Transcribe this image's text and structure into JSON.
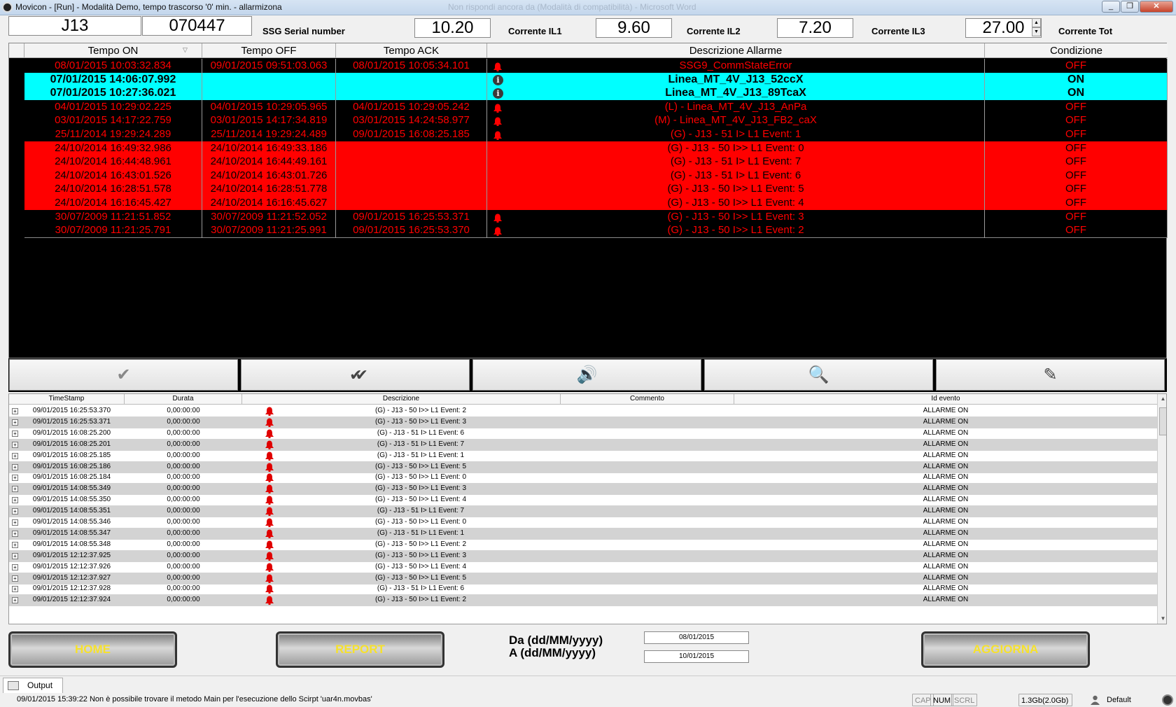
{
  "window": {
    "title": "Movicon - [Run] - Modalità Demo, tempo trascorso '0' min. - allarmizona",
    "ghost_title": "Non rispondi ancora da (Modalità di compatibilità) - Microsoft Word"
  },
  "header": {
    "device": "J13",
    "serial_value": "070447",
    "serial_label": "SSG Serial number",
    "il1_value": "10.20",
    "il1_label": "Corrente IL1",
    "il2_value": "9.60",
    "il2_label": "Corrente IL2",
    "il3_value": "7.20",
    "il3_label": "Corrente IL3",
    "tot_value": "27.00",
    "tot_label": "Corrente Tot"
  },
  "alarm_table": {
    "columns": [
      "Tempo ON",
      "Tempo OFF",
      "Tempo ACK",
      "Descrizione Allarme",
      "Condizione"
    ],
    "rows": [
      {
        "on": "08/01/2015 10:03:32.834",
        "off": "09/01/2015 09:51:03.063",
        "ack": "08/01/2015 10:05:34.101",
        "icon": "bell",
        "desc": "SSG9_CommStateError",
        "cond": "OFF",
        "style": "black"
      },
      {
        "on": "07/01/2015 14:06:07.992",
        "off": "",
        "ack": "",
        "icon": "info",
        "desc": "Linea_MT_4V_J13_52ccX",
        "cond": "ON",
        "style": "cyan"
      },
      {
        "on": "07/01/2015 10:27:36.021",
        "off": "",
        "ack": "",
        "icon": "info",
        "desc": "Linea_MT_4V_J13_89TcaX",
        "cond": "ON",
        "style": "cyan"
      },
      {
        "on": "04/01/2015 10:29:02.225",
        "off": "04/01/2015 10:29:05.965",
        "ack": "04/01/2015 10:29:05.242",
        "icon": "bell",
        "desc": "(L) - Linea_MT_4V_J13_AnPa",
        "cond": "OFF",
        "style": "black"
      },
      {
        "on": "03/01/2015 14:17:22.759",
        "off": "03/01/2015 14:17:34.819",
        "ack": "03/01/2015 14:24:58.977",
        "icon": "bell",
        "desc": "(M) - Linea_MT_4V_J13_FB2_caX",
        "cond": "OFF",
        "style": "black"
      },
      {
        "on": "25/11/2014 19:29:24.289",
        "off": "25/11/2014 19:29:24.489",
        "ack": "09/01/2015 16:08:25.185",
        "icon": "bell",
        "desc": "(G) - J13 - 51 I> L1  Event: 1",
        "cond": "OFF",
        "style": "black"
      },
      {
        "on": "24/10/2014 16:49:32.986",
        "off": "24/10/2014 16:49:33.186",
        "ack": "",
        "icon": "",
        "desc": "(G) - J13 - 50 I>> L1  Event: 0",
        "cond": "OFF",
        "style": "red"
      },
      {
        "on": "24/10/2014 16:44:48.961",
        "off": "24/10/2014 16:44:49.161",
        "ack": "",
        "icon": "",
        "desc": "(G) - J13 - 51 I> L1  Event: 7",
        "cond": "OFF",
        "style": "red"
      },
      {
        "on": "24/10/2014 16:43:01.526",
        "off": "24/10/2014 16:43:01.726",
        "ack": "",
        "icon": "",
        "desc": "(G) - J13 - 51 I> L1  Event: 6",
        "cond": "OFF",
        "style": "red"
      },
      {
        "on": "24/10/2014 16:28:51.578",
        "off": "24/10/2014 16:28:51.778",
        "ack": "",
        "icon": "",
        "desc": "(G) - J13 - 50 I>> L1  Event: 5",
        "cond": "OFF",
        "style": "red"
      },
      {
        "on": "24/10/2014 16:16:45.427",
        "off": "24/10/2014 16:16:45.627",
        "ack": "",
        "icon": "",
        "desc": "(G) - J13 - 50 I>> L1  Event: 4",
        "cond": "OFF",
        "style": "red"
      },
      {
        "on": "30/07/2009 11:21:51.852",
        "off": "30/07/2009 11:21:52.052",
        "ack": "09/01/2015 16:25:53.371",
        "icon": "bell",
        "desc": "(G) - J13 - 50 I>> L1  Event: 3",
        "cond": "OFF",
        "style": "black"
      },
      {
        "on": "30/07/2009 11:21:25.791",
        "off": "30/07/2009 11:21:25.991",
        "ack": "09/01/2015 16:25:53.370",
        "icon": "bell",
        "desc": "(G) - J13 - 50 I>> L1  Event: 2",
        "cond": "OFF",
        "style": "black"
      }
    ]
  },
  "toolbar": {
    "buttons": [
      {
        "name": "ack-selected-button",
        "glyph": "✔"
      },
      {
        "name": "ack-all-button",
        "glyph": "✔✔"
      },
      {
        "name": "silence-horn-button",
        "glyph": "🔊"
      },
      {
        "name": "alarm-help-button",
        "glyph": "🔍"
      },
      {
        "name": "comment-button",
        "glyph": "✎"
      }
    ]
  },
  "history_table": {
    "columns": [
      "TimeStamp",
      "Durata",
      "Descrizione",
      "Commento",
      "Id evento"
    ],
    "rows": [
      {
        "ts": "09/01/2015 16:25:53.370",
        "dur": "0,00:00:00",
        "desc": "(G) - J13 - 50 I>> L1  Event: 2",
        "id": "ALLARME ON"
      },
      {
        "ts": "09/01/2015 16:25:53.371",
        "dur": "0,00:00:00",
        "desc": "(G) - J13 - 50 I>> L1  Event: 3",
        "id": "ALLARME ON"
      },
      {
        "ts": "09/01/2015 16:08:25.200",
        "dur": "0,00:00:00",
        "desc": "(G) - J13 - 51 I> L1  Event: 6",
        "id": "ALLARME ON"
      },
      {
        "ts": "09/01/2015 16:08:25.201",
        "dur": "0,00:00:00",
        "desc": "(G) - J13 - 51 I> L1  Event: 7",
        "id": "ALLARME ON"
      },
      {
        "ts": "09/01/2015 16:08:25.185",
        "dur": "0,00:00:00",
        "desc": "(G) - J13 - 51 I> L1  Event: 1",
        "id": "ALLARME ON"
      },
      {
        "ts": "09/01/2015 16:08:25.186",
        "dur": "0,00:00:00",
        "desc": "(G) - J13 - 50 I>> L1  Event: 5",
        "id": "ALLARME ON"
      },
      {
        "ts": "09/01/2015 16:08:25.184",
        "dur": "0,00:00:00",
        "desc": "(G) - J13 - 50 I>> L1  Event: 0",
        "id": "ALLARME ON"
      },
      {
        "ts": "09/01/2015 14:08:55.349",
        "dur": "0,00:00:00",
        "desc": "(G) - J13 - 50 I>> L1  Event: 3",
        "id": "ALLARME ON"
      },
      {
        "ts": "09/01/2015 14:08:55.350",
        "dur": "0,00:00:00",
        "desc": "(G) - J13 - 50 I>> L1  Event: 4",
        "id": "ALLARME ON"
      },
      {
        "ts": "09/01/2015 14:08:55.351",
        "dur": "0,00:00:00",
        "desc": "(G) - J13 - 51 I> L1  Event: 7",
        "id": "ALLARME ON"
      },
      {
        "ts": "09/01/2015 14:08:55.346",
        "dur": "0,00:00:00",
        "desc": "(G) - J13 - 50 I>> L1  Event: 0",
        "id": "ALLARME ON"
      },
      {
        "ts": "09/01/2015 14:08:55.347",
        "dur": "0,00:00:00",
        "desc": "(G) - J13 - 51 I> L1  Event: 1",
        "id": "ALLARME ON"
      },
      {
        "ts": "09/01/2015 14:08:55.348",
        "dur": "0,00:00:00",
        "desc": "(G) - J13 - 50 I>> L1  Event: 2",
        "id": "ALLARME ON"
      },
      {
        "ts": "09/01/2015 12:12:37.925",
        "dur": "0,00:00:00",
        "desc": "(G) - J13 - 50 I>> L1  Event: 3",
        "id": "ALLARME ON"
      },
      {
        "ts": "09/01/2015 12:12:37.926",
        "dur": "0,00:00:00",
        "desc": "(G) - J13 - 50 I>> L1  Event: 4",
        "id": "ALLARME ON"
      },
      {
        "ts": "09/01/2015 12:12:37.927",
        "dur": "0,00:00:00",
        "desc": "(G) - J13 - 50 I>> L1  Event: 5",
        "id": "ALLARME ON"
      },
      {
        "ts": "09/01/2015 12:12:37.928",
        "dur": "0,00:00:00",
        "desc": "(G) - J13 - 51 I> L1  Event: 6",
        "id": "ALLARME ON"
      },
      {
        "ts": "09/01/2015 12:12:37.924",
        "dur": "0,00:00:00",
        "desc": "(G) - J13 - 50 I>> L1  Event: 2",
        "id": "ALLARME ON"
      }
    ]
  },
  "footer": {
    "home_label": "HOME",
    "report_label": "REPORT",
    "refresh_label": "AGGIORNA",
    "from_label": "Da (dd/MM/yyyy)",
    "to_label": "A  (dd/MM/yyyy)",
    "from_date": "08/01/2015",
    "to_date": "10/01/2015"
  },
  "output": {
    "tab_label": "Output",
    "message": "09/01/2015 15:39:22 Non è possibile trovare il metodo Main per l'esecuzione dello Scirpt 'uar4n.movbas'"
  },
  "statusbar": {
    "cap": "CAP",
    "num": "NUM",
    "scrl": "SCRL",
    "memory": "1.3Gb(2.0Gb)",
    "user": "Default"
  },
  "colors": {
    "alarm_red": "#ff0000",
    "alarm_cyan": "#00ffff",
    "button_text": "#f6e12c"
  }
}
